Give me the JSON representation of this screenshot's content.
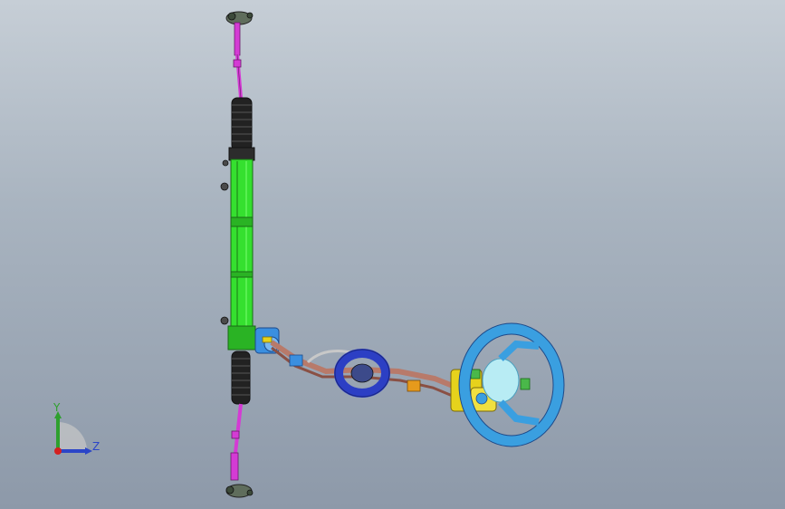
{
  "viewport": {
    "background_top": "#c6ced6",
    "background_bottom": "#8d99a9",
    "model": "steering-system-assembly"
  },
  "parts": {
    "tie_rod_color": "#d43bd4",
    "rack_housing_color": "#35e02f",
    "boot_color": "#1c1c1c",
    "intermediate_shaft_color": "#b87a6a",
    "column_bracket_color": "#2c3fc4",
    "motor_color": "#e6d21c",
    "steering_wheel_color": "#3a9fe0"
  },
  "triad": {
    "y_label": "Y",
    "z_label": "Z",
    "y_color": "#2ea02e",
    "z_color": "#2b45c8",
    "origin_color": "#d42020"
  }
}
